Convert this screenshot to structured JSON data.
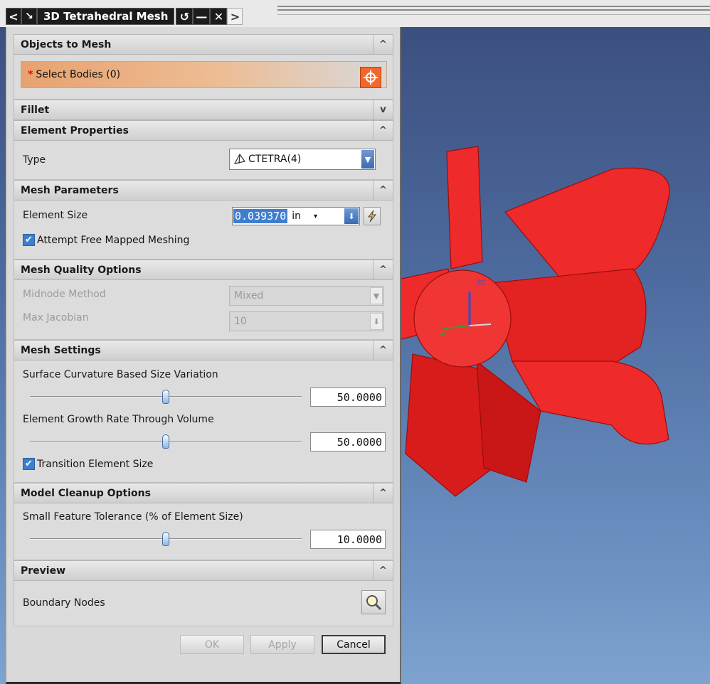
{
  "titlebar": {
    "title": "3D Tetrahedral Mesh",
    "back_glyph": "<",
    "pin_glyph": "↘",
    "reset_glyph": "↺",
    "minimize_glyph": "—",
    "close_glyph": "✕",
    "forward_glyph": ">"
  },
  "sections": {
    "objects": {
      "header": "Objects to Mesh",
      "caret": "^",
      "required_mark": "*",
      "select_bodies": "Select Bodies (0)"
    },
    "fillet": {
      "header": "Fillet",
      "caret": "v"
    },
    "element_properties": {
      "header": "Element Properties",
      "caret": "^",
      "type_label": "Type",
      "type_value": "CTETRA(4)"
    },
    "mesh_parameters": {
      "header": "Mesh Parameters",
      "caret": "^",
      "element_size_label": "Element Size",
      "element_size_value": "0.039370",
      "unit": "in",
      "attempt_free_mapped": "Attempt Free Mapped Meshing",
      "attempt_free_mapped_checked": true
    },
    "mesh_quality": {
      "header": "Mesh Quality Options",
      "caret": "^",
      "midnode_label": "Midnode Method",
      "midnode_value": "Mixed",
      "max_jacobian_label": "Max Jacobian",
      "max_jacobian_value": "10"
    },
    "mesh_settings": {
      "header": "Mesh Settings",
      "caret": "^",
      "curvature_label": "Surface Curvature Based Size Variation",
      "curvature_value": "50.0000",
      "growth_label": "Element Growth Rate Through Volume",
      "growth_value": "50.0000",
      "transition_label": "Transition Element Size",
      "transition_checked": true
    },
    "model_cleanup": {
      "header": "Model Cleanup Options",
      "caret": "^",
      "tolerance_label": "Small Feature Tolerance (% of Element Size)",
      "tolerance_value": "10.0000"
    },
    "preview": {
      "header": "Preview",
      "caret": "^",
      "boundary_label": "Boundary Nodes"
    }
  },
  "buttons": {
    "ok": "OK",
    "apply": "Apply",
    "cancel": "Cancel"
  },
  "viewport": {
    "axis_z": "ZC",
    "axis_x": "XC",
    "model_color": "#ee2a2a"
  },
  "colors": {
    "accent": "#3f7ecf",
    "select_btn": "#f3672c"
  }
}
